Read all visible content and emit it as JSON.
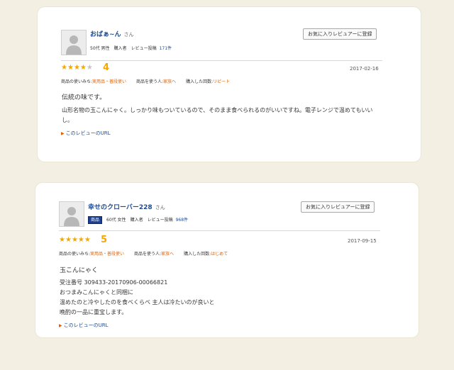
{
  "reviews": [
    {
      "user": {
        "name": "おばぁ~ん",
        "honorific": "さん",
        "age_gender": "50代 男性",
        "buyer": "購入者",
        "review_label": "レビュー投稿",
        "review_count": "171件",
        "badge": ""
      },
      "fav_button": "お気に入りレビュアーに登録",
      "rating": 4,
      "rating_text": "4",
      "date": "2017-02-16",
      "props": {
        "usage_label": "商品の使いみち:",
        "usage_value": "実用品・普段使い",
        "for_whom_label": "商品を使う人:",
        "for_whom_value": "家族へ",
        "times_label": "購入した回数:",
        "times_value": "リピート"
      },
      "title": "伝統の味です。",
      "body": [
        "山形名物の玉こんにゃく。しっかり味もついているので、そのまま食べられるのがいいですね。電子レンジで温めてもいい",
        "し。"
      ],
      "url_link": "このレビューのURL"
    },
    {
      "user": {
        "name": "幸せのクローバー228",
        "honorific": "さん",
        "age_gender": "60代 女性",
        "buyer": "購入者",
        "review_label": "レビュー投稿",
        "review_count": "968件",
        "badge": "商品"
      },
      "fav_button": "お気に入りレビュアーに登録",
      "rating": 5,
      "rating_text": "5",
      "date": "2017-09-15",
      "props": {
        "usage_label": "商品の使いみち:",
        "usage_value": "実用品・普段使い",
        "for_whom_label": "商品を使う人:",
        "for_whom_value": "家族へ",
        "times_label": "購入した回数:",
        "times_value": "はじめて"
      },
      "title": "玉こんにゃく",
      "body": [
        "受注番号 309433-20170906-00066821",
        "おつまみこんにゃくと同梱に",
        "温めたのと冷やしたのを食べくらべ 主人は冷たいのが良いと",
        "晩酌の一品に重宝します。"
      ],
      "url_link": "このレビューのURL"
    }
  ],
  "colors": {
    "background": "#f3efe2",
    "link": "#1e4b8f",
    "star": "#f2a800",
    "accent": "#e06000"
  },
  "icons": {
    "avatar": "default-user-avatar-icon",
    "star": "star-icon",
    "link_arrow": "triangle-right-icon"
  }
}
